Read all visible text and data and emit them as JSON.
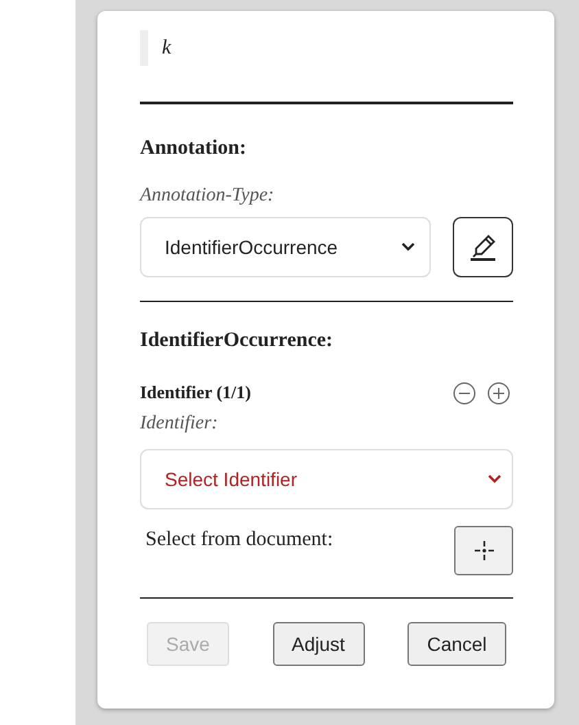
{
  "quote": "k",
  "annotation": {
    "heading": "Annotation:",
    "type_label": "Annotation-Type:",
    "type_value": "IdentifierOccurrence"
  },
  "occurrence": {
    "heading": "IdentifierOccurrence:",
    "group_title": "Identifier (1/1)",
    "field_label": "Identifier:",
    "placeholder": "Select Identifier",
    "document_label": "Select from document:"
  },
  "buttons": [
    {
      "label": "Save",
      "disabled": true
    },
    {
      "label": "Adjust",
      "disabled": false
    },
    {
      "label": "Cancel",
      "disabled": false
    }
  ]
}
